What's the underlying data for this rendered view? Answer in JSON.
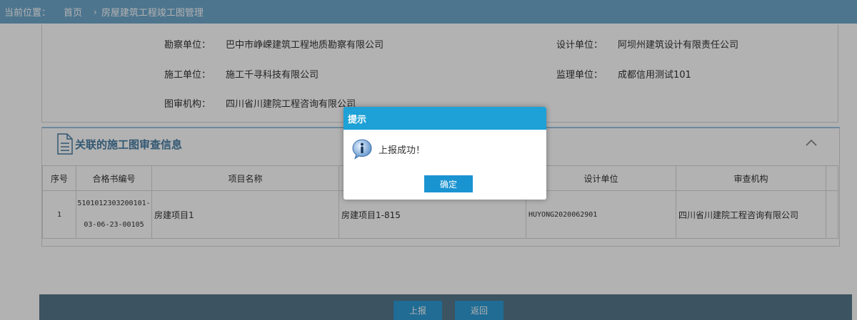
{
  "breadcrumb": {
    "prefix": "当前位置：",
    "home": "首页",
    "separator": "›",
    "current": "房屋建筑工程竣工图管理"
  },
  "info": {
    "survey_label": "勘察单位：",
    "survey_value": "巴中市峥嵘建筑工程地质勘察有限公司",
    "design_label": "设计单位：",
    "design_value": "阿坝州建筑设计有限责任公司",
    "construction_label": "施工单位：",
    "construction_value": "施工千寻科技有限公司",
    "supervision_label": "监理单位：",
    "supervision_value": "成都信用测试101",
    "review_label": "图审机构：",
    "review_value": "四川省川建院工程咨询有限公司"
  },
  "section": {
    "title": "关联的施工图审查信息",
    "columns": [
      "序号",
      "合格书编号",
      "项目名称",
      "",
      "设计单位",
      "审查机构",
      ""
    ],
    "rows": [
      {
        "index": "1",
        "cert_line1": "5101012303200101-",
        "cert_line2": "03-06-23-00105",
        "project_name": "房建项目1",
        "sub_project": "房建项目1-815",
        "design_unit": "HUYONG2020062901",
        "review_org": "四川省川建院工程咨询有限公司"
      }
    ]
  },
  "footer": {
    "report_label": "上报",
    "back_label": "返回"
  },
  "dialog": {
    "title": "提示",
    "message": "上报成功！",
    "ok_label": "确定"
  },
  "colors": {
    "topbar": "#6fa8cc",
    "dialog_header": "#1da1d6",
    "button": "#1a93d1",
    "footer_bar": "#56778c"
  }
}
